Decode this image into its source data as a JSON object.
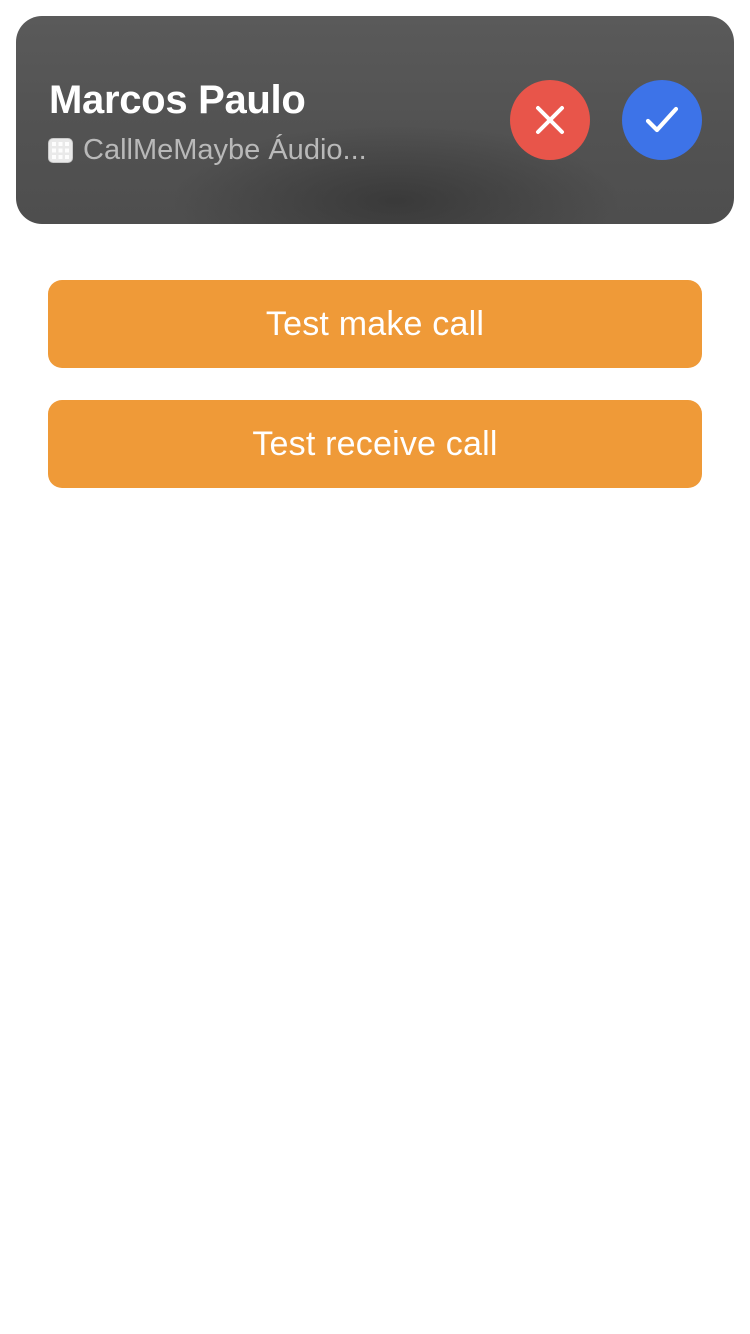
{
  "call_banner": {
    "caller_name": "Marcos Paulo",
    "app_label": "CallMeMaybe Áudio...",
    "app_icon": "app-grid-icon",
    "decline_icon": "close-icon",
    "accept_icon": "checkmark-icon",
    "colors": {
      "banner_background": "#525252",
      "decline": "#e8554a",
      "accept": "#3d73e8"
    }
  },
  "actions": {
    "make_call_label": "Test make call",
    "receive_call_label": "Test receive call",
    "button_color": "#ef9a38"
  }
}
